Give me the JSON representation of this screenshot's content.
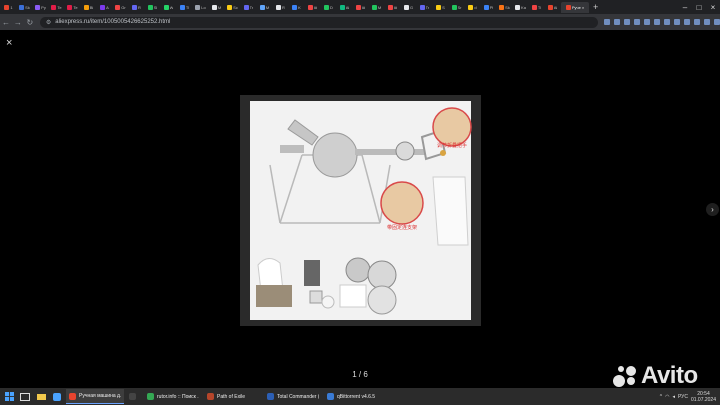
{
  "browser": {
    "tabs": [
      {
        "label": "1",
        "color": "#e8442e"
      },
      {
        "label": "Sk",
        "color": "#3b6fd8"
      },
      {
        "label": "Py",
        "color": "#8b5cf6"
      },
      {
        "label": "Te",
        "color": "#e11d48"
      },
      {
        "label": "Te",
        "color": "#e11d48"
      },
      {
        "label": "Bi",
        "color": "#f59e0b"
      },
      {
        "label": "A",
        "color": "#7c3aed"
      },
      {
        "label": "Gr",
        "color": "#ef4444"
      },
      {
        "label": "R",
        "color": "#6366f1"
      },
      {
        "label": "Sl",
        "color": "#22c55e"
      },
      {
        "label": "W",
        "color": "#25d366"
      },
      {
        "label": "Tl",
        "color": "#3b82f6"
      },
      {
        "label": "Lo",
        "color": "#9ca3af"
      },
      {
        "label": "M",
        "color": "#e5e7eb"
      },
      {
        "label": "Sc",
        "color": "#facc15"
      },
      {
        "label": "Tr",
        "color": "#6366f1"
      },
      {
        "label": "M",
        "color": "#60a5fa"
      },
      {
        "label": "R",
        "color": "#e5e7eb"
      },
      {
        "label": "K",
        "color": "#3b82f6"
      },
      {
        "label": "Af",
        "color": "#ef4444"
      },
      {
        "label": "D",
        "color": "#22c55e"
      },
      {
        "label": "Ai",
        "color": "#10b981"
      },
      {
        "label": "Af",
        "color": "#ef4444"
      },
      {
        "label": "M",
        "color": "#22c55e"
      },
      {
        "label": "Af",
        "color": "#ef4444"
      },
      {
        "label": "G",
        "color": "#e5e7eb"
      },
      {
        "label": "Tr",
        "color": "#6366f1"
      },
      {
        "label": "S",
        "color": "#facc15"
      },
      {
        "label": "Sr",
        "color": "#22c55e"
      },
      {
        "label": "d",
        "color": "#facc15"
      },
      {
        "label": "Pl",
        "color": "#3b82f6"
      },
      {
        "label": "Sk",
        "color": "#f97316"
      },
      {
        "label": "Ka",
        "color": "#e5e7eb"
      },
      {
        "label": "Ti",
        "color": "#ef4444"
      },
      {
        "label": "Ai",
        "color": "#e8442e"
      }
    ],
    "active_tab": {
      "label": "Руче",
      "color": "#e8442e",
      "close": "×"
    },
    "new_tab": "+",
    "window_controls": {
      "minimize": "–",
      "maximize": "□",
      "close": "×"
    },
    "url": "aliexpress.ru/item/1005005426625252.html",
    "nav": {
      "back": "←",
      "forward": "→",
      "reload": "↻",
      "site_info": "⚙"
    }
  },
  "viewer": {
    "close_label": "×",
    "next_label": "›",
    "counter": "1 / 6",
    "product_labels": {
      "label_top": "调节折叠把手",
      "label_bottom": "带固定连支架"
    }
  },
  "watermark": {
    "text": "Avito"
  },
  "taskbar": {
    "apps": [
      {
        "label": "Ручная машина д...",
        "color": "#e8442e",
        "active": true
      },
      {
        "label": "",
        "color": "#444",
        "active": false
      },
      {
        "label": "rutor.info :: Поиск ...",
        "color": "#34a853",
        "active": false
      },
      {
        "label": "Path of Exile",
        "color": "#b5452a",
        "active": false
      },
      {
        "label": "Total Commander (...",
        "color": "#2c5fb5",
        "active": false
      },
      {
        "label": "qBittorrent v4.6.5",
        "color": "#3a7bd5",
        "active": false
      }
    ],
    "tray": {
      "lang": "РУС",
      "time": "20:54",
      "date": "01.07.2024"
    }
  }
}
